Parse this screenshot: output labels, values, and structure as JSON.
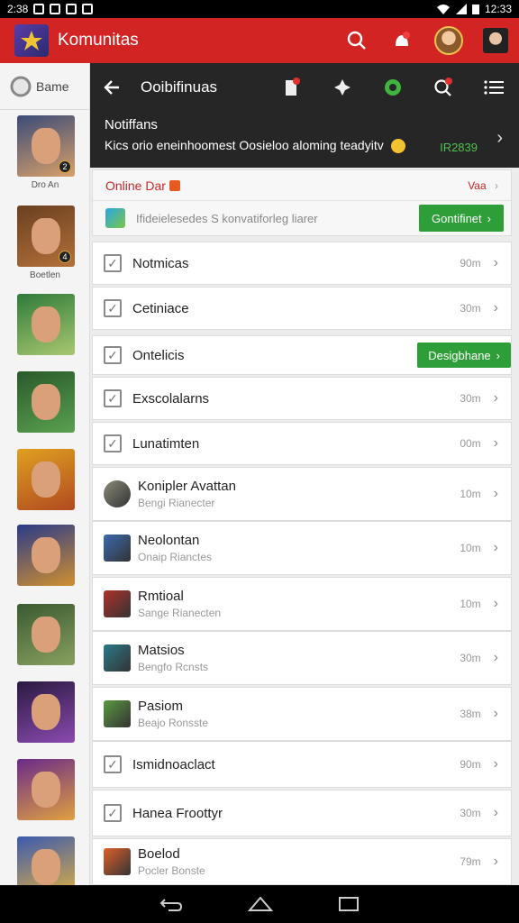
{
  "status_bar": {
    "time_left": "2:38",
    "time_right": "12:33"
  },
  "app_bar": {
    "title": "Komunitas",
    "icons": [
      "search-icon",
      "notification-icon",
      "profile-avatar",
      "account-avatar"
    ]
  },
  "sidebar": {
    "search_label": "Bame",
    "games": [
      {
        "caption": "Dro An",
        "badge": "2",
        "colors": [
          "#3a4b78",
          "#d8a06a"
        ]
      },
      {
        "caption": "Boetlen",
        "badge": "4",
        "colors": [
          "#6a4020",
          "#b3703a"
        ]
      },
      {
        "caption": "",
        "badge": "",
        "colors": [
          "#2f7a3a",
          "#a8c870"
        ]
      },
      {
        "caption": "",
        "badge": "",
        "colors": [
          "#2a5a2a",
          "#5aa050"
        ]
      },
      {
        "caption": "",
        "badge": "",
        "colors": [
          "#e0a020",
          "#b04a20"
        ]
      },
      {
        "caption": "",
        "badge": "",
        "colors": [
          "#2a3a8a",
          "#d09030"
        ]
      },
      {
        "caption": "",
        "badge": "",
        "colors": [
          "#3a5a30",
          "#88a060"
        ]
      },
      {
        "caption": "",
        "badge": "",
        "colors": [
          "#2a1a40",
          "#8a4ab0"
        ]
      },
      {
        "caption": "",
        "badge": "",
        "colors": [
          "#6a2a8a",
          "#e0a040"
        ]
      },
      {
        "caption": "",
        "badge": "",
        "colors": [
          "#3a5ab0",
          "#e0b040"
        ]
      }
    ]
  },
  "toolbar": {
    "title": "Ooibifinuas"
  },
  "notification": {
    "title": "Notiffans",
    "text": "Kics orio eneinhoomest Oosieloo aloming teadyitv",
    "meta": "IR2839"
  },
  "online_card": {
    "title": "Online Dar",
    "head_right": "Vaa",
    "text": "Ifideielesedes S konvatiforleg liarer",
    "button": "Gontifinet"
  },
  "rows": [
    {
      "label": "Notmicas",
      "time": "90m"
    },
    {
      "label": "Cetiniace",
      "time": "30m"
    },
    {
      "label": "Ontelicis",
      "button": "Desigbhane"
    },
    {
      "label": "Exscolalarns",
      "time": "30m"
    },
    {
      "label": "Lunatimten",
      "time": "00m"
    },
    {
      "label": "Konipler Avattan",
      "sub": "Bengi Rianecter",
      "time": "10m"
    },
    {
      "label": "Neolontan",
      "sub": "Onaip Rianctes",
      "time": "10m"
    },
    {
      "label": "Rmtioal",
      "sub": "Sange Rianecten",
      "time": "10m"
    },
    {
      "label": "Matsios",
      "sub": "Bengfo Rcnsts",
      "time": "30m"
    },
    {
      "label": "Pasiom",
      "sub": "Beajo Ronsste",
      "time": "38m"
    },
    {
      "label": "Ismidnoaclact",
      "time": "90m"
    },
    {
      "label": "Hanea Froottyr",
      "time": "30m"
    },
    {
      "label": "Boelod",
      "sub": "Pocler Bonste",
      "time": "79m"
    }
  ]
}
